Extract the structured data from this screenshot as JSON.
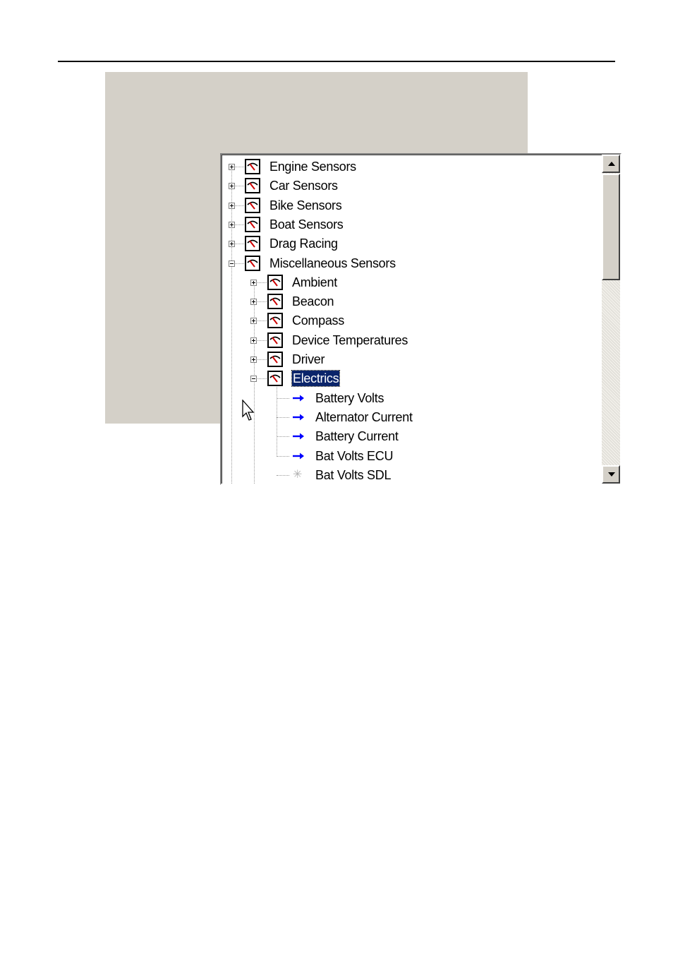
{
  "tree": {
    "root_items": [
      {
        "label": "Engine Sensors",
        "icon": "gauge-icon",
        "state": "collapsed"
      },
      {
        "label": "Car Sensors",
        "icon": "gauge-icon",
        "state": "collapsed"
      },
      {
        "label": "Bike Sensors",
        "icon": "gauge-icon",
        "state": "collapsed"
      },
      {
        "label": "Boat Sensors",
        "icon": "gauge-icon",
        "state": "collapsed"
      },
      {
        "label": "Drag Racing",
        "icon": "gauge-icon",
        "state": "collapsed"
      },
      {
        "label": "Miscellaneous Sensors",
        "icon": "gauge-icon",
        "state": "expanded"
      }
    ],
    "misc_children": [
      {
        "label": "Ambient",
        "icon": "gauge-icon",
        "state": "collapsed"
      },
      {
        "label": "Beacon",
        "icon": "gauge-icon",
        "state": "collapsed"
      },
      {
        "label": "Compass",
        "icon": "gauge-icon",
        "state": "collapsed"
      },
      {
        "label": "Device Temperatures",
        "icon": "gauge-icon",
        "state": "collapsed"
      },
      {
        "label": "Driver",
        "icon": "gauge-icon",
        "state": "collapsed"
      },
      {
        "label": "Electrics",
        "icon": "gauge-icon",
        "state": "expanded",
        "selected": true
      }
    ],
    "electrics_children": [
      {
        "label": "Battery Volts",
        "icon": "blue-arrow-icon"
      },
      {
        "label": "Alternator Current",
        "icon": "blue-arrow-icon"
      },
      {
        "label": "Battery Current",
        "icon": "blue-arrow-icon"
      },
      {
        "label": "Bat Volts ECU",
        "icon": "blue-arrow-icon"
      },
      {
        "label": "Bat Volts SDL",
        "icon": "gray-asterisk-icon"
      }
    ]
  },
  "colors": {
    "selection": "#0a246a",
    "arrow": "#0000ff",
    "gauge_needle": "#cc0000",
    "panel": "#d4d0c8"
  }
}
